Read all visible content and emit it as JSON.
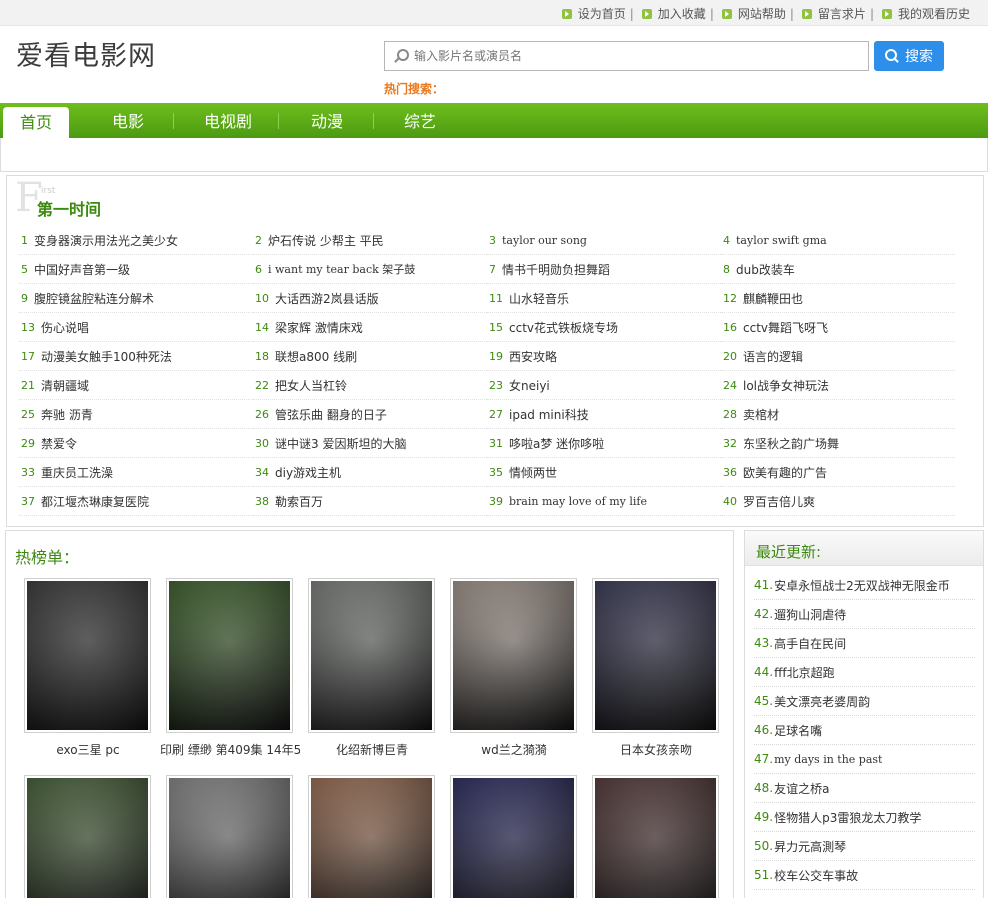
{
  "top_links": [
    "设为首页",
    "加入收藏",
    "网站帮助",
    "留言求片",
    "我的观看历史"
  ],
  "logo": "爱看电影网",
  "search": {
    "placeholder": "输入影片名或演员名",
    "button": "搜索",
    "hot_label": "热门搜索："
  },
  "nav": [
    "首页",
    "电影",
    "电视剧",
    "动漫",
    "综艺"
  ],
  "first_time": {
    "big_letter": "F",
    "small_letters": "irst",
    "title": "第一时间",
    "items": [
      {
        "n": "1",
        "t": "变身器演示用法光之美少女",
        "mono": false
      },
      {
        "n": "2",
        "t": "炉石传说 少帮主 平民",
        "mono": false
      },
      {
        "n": "3",
        "t": "taylor our song",
        "mono": true
      },
      {
        "n": "4",
        "t": "taylor swift gma",
        "mono": true
      },
      {
        "n": "5",
        "t": "中国好声音第一级",
        "mono": false
      },
      {
        "n": "6",
        "t": "i want my tear back 架子鼓",
        "mono": true
      },
      {
        "n": "7",
        "t": "情书千明勋负担舞蹈",
        "mono": false
      },
      {
        "n": "8",
        "t": "dub改装车",
        "mono": false
      },
      {
        "n": "9",
        "t": "腹腔镜盆腔粘连分解术",
        "mono": false
      },
      {
        "n": "10",
        "t": "大话西游2岚县话版",
        "mono": false
      },
      {
        "n": "11",
        "t": "山水轻音乐",
        "mono": false
      },
      {
        "n": "12",
        "t": "麒麟鞭田也",
        "mono": false
      },
      {
        "n": "13",
        "t": "伤心说唱",
        "mono": false
      },
      {
        "n": "14",
        "t": "梁家辉 激情床戏",
        "mono": false
      },
      {
        "n": "15",
        "t": "cctv花式铁板烧专场",
        "mono": false
      },
      {
        "n": "16",
        "t": "cctv舞蹈飞呀飞",
        "mono": false
      },
      {
        "n": "17",
        "t": "动漫美女触手100种死法",
        "mono": false
      },
      {
        "n": "18",
        "t": "联想a800 线刷",
        "mono": false
      },
      {
        "n": "19",
        "t": "西安攻略",
        "mono": false
      },
      {
        "n": "20",
        "t": "语言的逻辑",
        "mono": false
      },
      {
        "n": "21",
        "t": "清朝疆域",
        "mono": false
      },
      {
        "n": "22",
        "t": "把女人当杠铃",
        "mono": false
      },
      {
        "n": "23",
        "t": "女neiyi",
        "mono": false
      },
      {
        "n": "24",
        "t": "lol战争女神玩法",
        "mono": false
      },
      {
        "n": "25",
        "t": "奔驰 沥青",
        "mono": false
      },
      {
        "n": "26",
        "t": "管弦乐曲 翻身的日子",
        "mono": false
      },
      {
        "n": "27",
        "t": "ipad mini科技",
        "mono": false
      },
      {
        "n": "28",
        "t": "卖棺材",
        "mono": false
      },
      {
        "n": "29",
        "t": "禁爱令",
        "mono": false
      },
      {
        "n": "30",
        "t": "谜中谜3 爱因斯坦的大脑",
        "mono": false
      },
      {
        "n": "31",
        "t": "哆啦a梦 迷你哆啦",
        "mono": false
      },
      {
        "n": "32",
        "t": "东坚秋之韵广场舞",
        "mono": false
      },
      {
        "n": "33",
        "t": "重庆员工洗澡",
        "mono": false
      },
      {
        "n": "34",
        "t": "diy游戏主机",
        "mono": false
      },
      {
        "n": "35",
        "t": "情倾两世",
        "mono": false
      },
      {
        "n": "36",
        "t": "欧美有趣的广告",
        "mono": false
      },
      {
        "n": "37",
        "t": "都江堰杰琳康复医院",
        "mono": false
      },
      {
        "n": "38",
        "t": "勒索百万",
        "mono": false
      },
      {
        "n": "39",
        "t": "brain may love of my life",
        "mono": true
      },
      {
        "n": "40",
        "t": "罗百吉倍儿爽",
        "mono": false
      }
    ]
  },
  "hot_list": {
    "title": "热榜单：",
    "items": [
      {
        "cap": "exo三星 pc",
        "theme": "#3a3a3a"
      },
      {
        "cap": "印刷 缥缈 第409集 14年5",
        "theme": "#3f6b2a"
      },
      {
        "cap": "化绍新博巨青",
        "theme": "#8a8f8a"
      },
      {
        "cap": "wd兰之漪漪",
        "theme": "#b9aaa0"
      },
      {
        "cap": "日本女孩亲吻",
        "theme": "#3a3a5c"
      },
      {
        "cap": "",
        "theme": "#4b6a3a"
      },
      {
        "cap": "",
        "theme": "#9a9a9a"
      },
      {
        "cap": "",
        "theme": "#b07a5a"
      },
      {
        "cap": "",
        "theme": "#2a2a6a"
      },
      {
        "cap": "",
        "theme": "#5a3a3a"
      }
    ]
  },
  "latest": {
    "title": "最近更新:",
    "items": [
      {
        "n": "41.",
        "t": "安卓永恒战士2无双战神无限金币"
      },
      {
        "n": "42.",
        "t": "遛狗山洞虐待"
      },
      {
        "n": "43.",
        "t": "高手自在民间"
      },
      {
        "n": "44.",
        "t": "fff北京超跑"
      },
      {
        "n": "45.",
        "t": "美文漂亮老婆周韵"
      },
      {
        "n": "46.",
        "t": "足球名嘴"
      },
      {
        "n": "47.",
        "t": "my days in the past"
      },
      {
        "n": "48.",
        "t": "友谊之桥a"
      },
      {
        "n": "49.",
        "t": "怪物猎人p3雷狼龙太刀教学"
      },
      {
        "n": "50.",
        "t": "昇力元高測琴"
      },
      {
        "n": "51.",
        "t": "校车公交车事故"
      }
    ]
  }
}
